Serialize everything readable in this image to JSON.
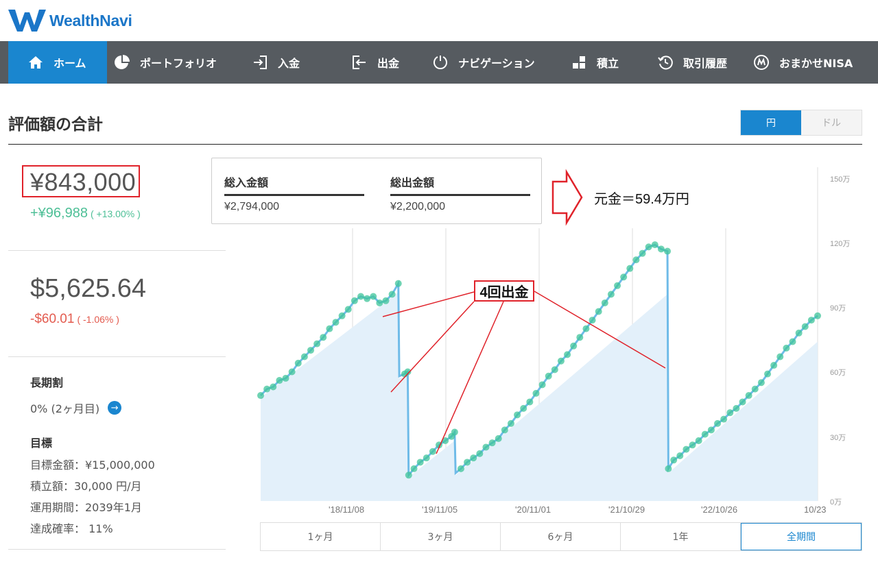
{
  "app": {
    "logo_text": "WealthNavi",
    "brand_color": "#1b76c8",
    "accent_color": "#1a86cf"
  },
  "nav": {
    "items": [
      {
        "label": "ホーム",
        "icon": "home-icon",
        "active": true
      },
      {
        "label": "ポートフォリオ",
        "icon": "pie-chart-icon",
        "active": false
      },
      {
        "label": "入金",
        "icon": "deposit-icon",
        "active": false
      },
      {
        "label": "出金",
        "icon": "withdraw-icon",
        "active": false
      },
      {
        "label": "ナビゲーション",
        "icon": "navigation-icon",
        "active": false
      },
      {
        "label": "積立",
        "icon": "blocks-icon",
        "active": false
      },
      {
        "label": "取引履歴",
        "icon": "history-icon",
        "active": false
      },
      {
        "label": "おまかせNISA",
        "icon": "nisa-icon",
        "active": false
      }
    ]
  },
  "section": {
    "title": "評価額の合計",
    "currency_toggle": {
      "options": [
        "円",
        "ドル"
      ],
      "selected": "円"
    }
  },
  "summary_left": {
    "yen_total": "¥843,000",
    "yen_gain": "+¥96,988",
    "yen_gain_pct": "( +13.00% )",
    "usd_total": "$5,625.64",
    "usd_change": "-$60.01",
    "usd_change_pct": "( -1.06% )",
    "long_term_heading": "長期割",
    "long_term_value": "0% (2ヶ月目)",
    "goal_heading": "目標",
    "goal_amount": "目標金額：¥15,000,000",
    "goal_monthly": "積立額：30,000 円/月",
    "goal_period": "運用期間：2039年1月",
    "goal_probability": "達成確率： 11%"
  },
  "summary_box": {
    "deposit_label": "総入金額",
    "deposit_value": "¥2,794,000",
    "withdraw_label": "総出金額",
    "withdraw_value": "¥2,200,000"
  },
  "annotations": {
    "principal_note": "元金＝59.4万円",
    "withdraw_note": "4回出金",
    "annotation_color": "#e0222a"
  },
  "period_tabs": {
    "options": [
      "1ヶ月",
      "3ヶ月",
      "6ヶ月",
      "1年",
      "全期間"
    ],
    "selected": "全期間"
  },
  "chart_data": {
    "type": "line",
    "x_ticks": [
      "'18/11/08",
      "'19/11/05",
      "'20/11/01",
      "'21/10/29",
      "'22/10/26",
      "10/23"
    ],
    "y_ticks": [
      "0万",
      "30万",
      "60万",
      "90万",
      "120万",
      "150万"
    ],
    "ylim": [
      0,
      155
    ],
    "unit": "万円",
    "grid": "vertical",
    "series": [
      {
        "role": "valuation",
        "color": "#6fbbe8",
        "marker_color": "#3fc49a",
        "points": [
          [
            0,
            49
          ],
          [
            2,
            52
          ],
          [
            4,
            53
          ],
          [
            6,
            56
          ],
          [
            8,
            57
          ],
          [
            10,
            60
          ],
          [
            12,
            64
          ],
          [
            14,
            67
          ],
          [
            16,
            70
          ],
          [
            18,
            73
          ],
          [
            20,
            76
          ],
          [
            22,
            80
          ],
          [
            24,
            83
          ],
          [
            26,
            86
          ],
          [
            28,
            89
          ],
          [
            30,
            93
          ],
          [
            32,
            95
          ],
          [
            34,
            94
          ],
          [
            36,
            95
          ],
          [
            38,
            92
          ],
          [
            40,
            93
          ],
          [
            42,
            96
          ],
          [
            44,
            101
          ],
          [
            44.3,
            58
          ],
          [
            46,
            59
          ],
          [
            47,
            60
          ],
          [
            47.3,
            12
          ],
          [
            49,
            15
          ],
          [
            51,
            18
          ],
          [
            53,
            20
          ],
          [
            55,
            23
          ],
          [
            57,
            26
          ],
          [
            59,
            28
          ],
          [
            61,
            30
          ],
          [
            62,
            32
          ],
          [
            62.3,
            13
          ],
          [
            64,
            15
          ],
          [
            66,
            18
          ],
          [
            68,
            20
          ],
          [
            70,
            22
          ],
          [
            72,
            25
          ],
          [
            74,
            27
          ],
          [
            76,
            29
          ],
          [
            78,
            33
          ],
          [
            80,
            36
          ],
          [
            82,
            40
          ],
          [
            84,
            43
          ],
          [
            86,
            46
          ],
          [
            88,
            50
          ],
          [
            90,
            54
          ],
          [
            92,
            58
          ],
          [
            94,
            61
          ],
          [
            96,
            65
          ],
          [
            98,
            68
          ],
          [
            100,
            72
          ],
          [
            102,
            76
          ],
          [
            104,
            80
          ],
          [
            106,
            84
          ],
          [
            108,
            88
          ],
          [
            110,
            92
          ],
          [
            112,
            96
          ],
          [
            114,
            100
          ],
          [
            116,
            104
          ],
          [
            118,
            108
          ],
          [
            120,
            112
          ],
          [
            122,
            115
          ],
          [
            124,
            118
          ],
          [
            126,
            119
          ],
          [
            128,
            117
          ],
          [
            130,
            116
          ],
          [
            130.3,
            15
          ],
          [
            132,
            19
          ],
          [
            134,
            21
          ],
          [
            136,
            24
          ],
          [
            138,
            26
          ],
          [
            140,
            28
          ],
          [
            142,
            31
          ],
          [
            144,
            33
          ],
          [
            146,
            36
          ],
          [
            148,
            38
          ],
          [
            150,
            41
          ],
          [
            152,
            43
          ],
          [
            154,
            46
          ],
          [
            156,
            49
          ],
          [
            158,
            52
          ],
          [
            160,
            55
          ],
          [
            162,
            59
          ],
          [
            164,
            63
          ],
          [
            166,
            67
          ],
          [
            168,
            71
          ],
          [
            170,
            74
          ],
          [
            172,
            78
          ],
          [
            174,
            81
          ],
          [
            176,
            84
          ],
          [
            178,
            86
          ]
        ]
      },
      {
        "role": "principal",
        "color": "#e3f0fa",
        "points": [
          [
            0,
            48
          ],
          [
            44,
            97
          ],
          [
            44.3,
            57
          ],
          [
            47,
            58
          ],
          [
            47.3,
            11
          ],
          [
            62,
            28
          ],
          [
            62.3,
            12
          ],
          [
            130,
            96
          ],
          [
            130.3,
            13
          ],
          [
            178,
            74
          ]
        ]
      }
    ]
  }
}
